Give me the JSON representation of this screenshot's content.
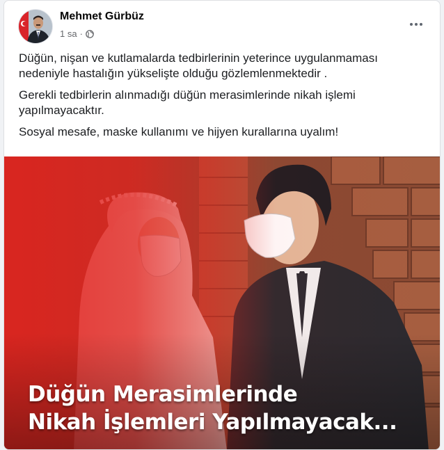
{
  "post": {
    "author": "Mehmet Gürbüz",
    "time": "1 sa",
    "separator": "·",
    "privacy_icon": "globe-icon",
    "more_icon": "more-options-icon",
    "paragraphs": [
      "Düğün, nişan ve kutlamalarda tedbirlerinin yeterince uygulanmaması nedeniyle hastalığın yükselişte olduğu gözlemlenmektedir .",
      "Gerekli tedbirlerin alınmadığı düğün merasimlerinde nikah işlemi yapılmayacaktır.",
      "Sosyal mesafe, maske kullanımı ve hijyen kurallarına uyalım!"
    ]
  },
  "image": {
    "caption_line1": "Düğün Merasimlerinde",
    "caption_line2": "Nikah İşlemleri Yapılmayacak..."
  },
  "colors": {
    "overlay_red": "#e0221e",
    "text_primary": "#1c1e21",
    "text_secondary": "#65676b"
  }
}
